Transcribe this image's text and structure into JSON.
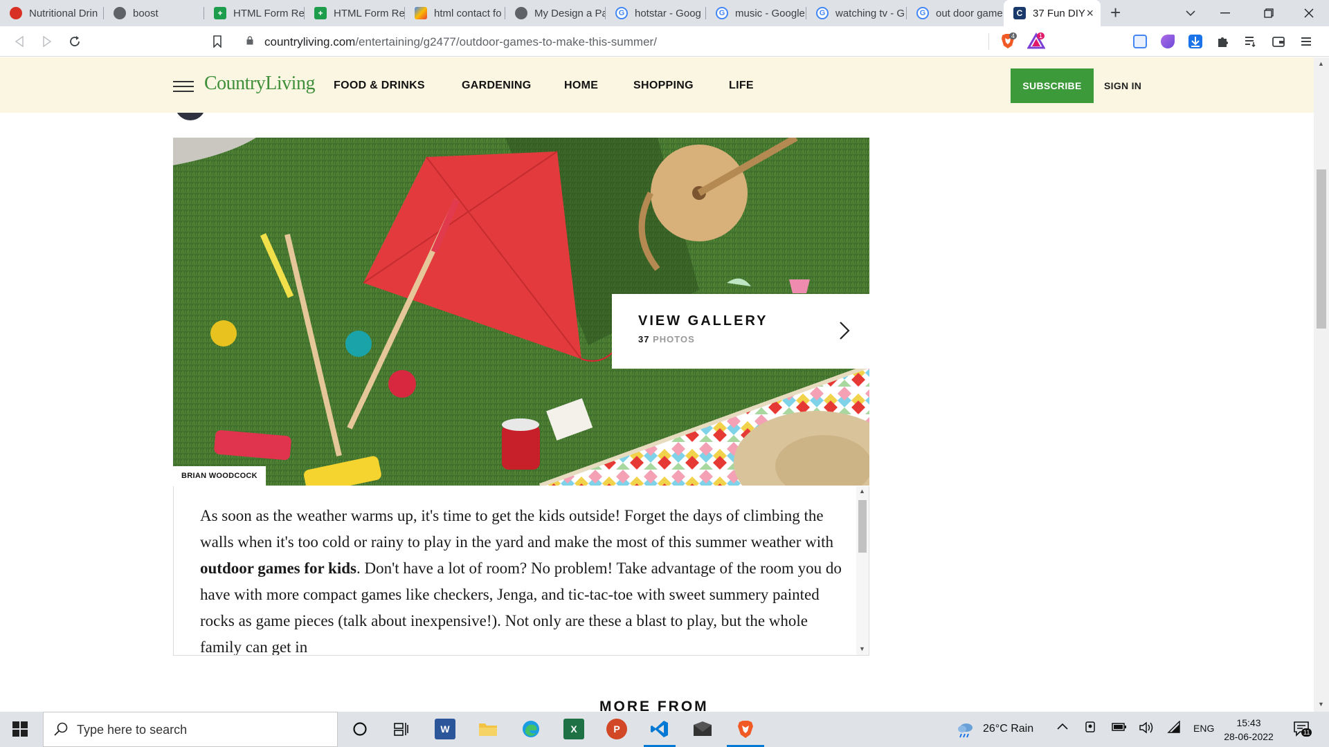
{
  "browser": {
    "tabs": [
      {
        "label": "Nutritional Drin",
        "icon": "red-brand-icon",
        "active": false
      },
      {
        "label": "boost",
        "icon": "globe-icon",
        "active": false
      },
      {
        "label": "HTML Form Re",
        "icon": "sheets-icon",
        "active": false
      },
      {
        "label": "HTML Form Re",
        "icon": "sheets-icon",
        "active": false
      },
      {
        "label": "html contact fo",
        "icon": "multicolor-icon",
        "active": false
      },
      {
        "label": "My Design a Pa",
        "icon": "globe-icon",
        "active": false
      },
      {
        "label": "hotstar - Goog",
        "icon": "google-icon",
        "active": false
      },
      {
        "label": "music - Google",
        "icon": "google-icon",
        "active": false
      },
      {
        "label": "watching tv - G",
        "icon": "google-icon",
        "active": false
      },
      {
        "label": "out door game",
        "icon": "google-icon",
        "active": false
      },
      {
        "label": "37 Fun DIY",
        "icon": "country-living-icon",
        "active": true
      }
    ],
    "new_tab_glyph": "+",
    "url_host": "countryliving.com",
    "url_path": "/entertaining/g2477/outdoor-games-to-make-this-summer/",
    "shield_count": "4",
    "reward_count": "1"
  },
  "site": {
    "logo": "CountryLiving",
    "nav": [
      "FOOD & DRINKS",
      "GARDENING",
      "HOME",
      "SHOPPING",
      "LIFE"
    ],
    "subscribe_label": "SUBSCRIBE",
    "signin_label": "SIGN IN",
    "brand_green": "#3c9a3a",
    "header_bg": "#fbf6e2"
  },
  "gallery": {
    "title": "VIEW GALLERY",
    "count": "37",
    "count_label": "PHOTOS",
    "credit": "BRIAN WOODCOCK"
  },
  "article": {
    "p1_before": "As soon as the weather warms up, it's time to get the kids outside! Forget the days of climbing the walls when it's too cold or rainy to play in the yard and make the most of this summer weather with ",
    "p1_bold": "outdoor games for kids",
    "p1_after": ". Don't have a lot of room? No problem! Take advantage of the room you do have with more compact games like checkers, Jenga, and tic-tac-toe with sweet summery painted rocks as game pieces (talk about inexpensive!). Not only are these a blast to play, but the whole family can get in"
  },
  "more_from": "MORE FROM",
  "taskbar": {
    "search_placeholder": "Type here to search",
    "weather": "26°C  Rain",
    "lang": "ENG",
    "time": "15:43",
    "date": "28-06-2022",
    "notif_count": "11"
  }
}
